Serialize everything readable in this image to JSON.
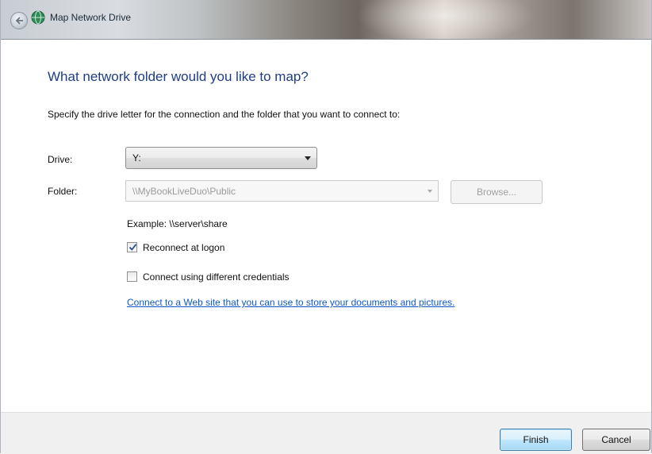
{
  "window": {
    "title": "Map Network Drive"
  },
  "main": {
    "heading": "What network folder would you like to map?",
    "instruction": "Specify the drive letter for the connection and the folder that you want to connect to:",
    "drive": {
      "label": "Drive:",
      "value": "Y:"
    },
    "folder": {
      "label": "Folder:",
      "value": "\\\\MyBookLiveDuo\\Public",
      "enabled": false
    },
    "browse_label": "Browse...",
    "example": "Example: \\\\server\\share",
    "reconnect": {
      "label": "Reconnect at logon",
      "checked": true
    },
    "different_credentials": {
      "label": "Connect using different credentials",
      "checked": false
    },
    "web_link": "Connect to a Web site that you can use to store your documents and pictures."
  },
  "buttons": {
    "finish": "Finish",
    "cancel": "Cancel"
  },
  "icons": {
    "back": "back-arrow-icon",
    "network_drive": "network-drive-icon",
    "checkmark": "checkmark-icon",
    "dropdown": "chevron-down-icon"
  },
  "colors": {
    "heading": "#1f3d86",
    "link": "#0e59c7",
    "button_bar": "#f0f0f0"
  }
}
